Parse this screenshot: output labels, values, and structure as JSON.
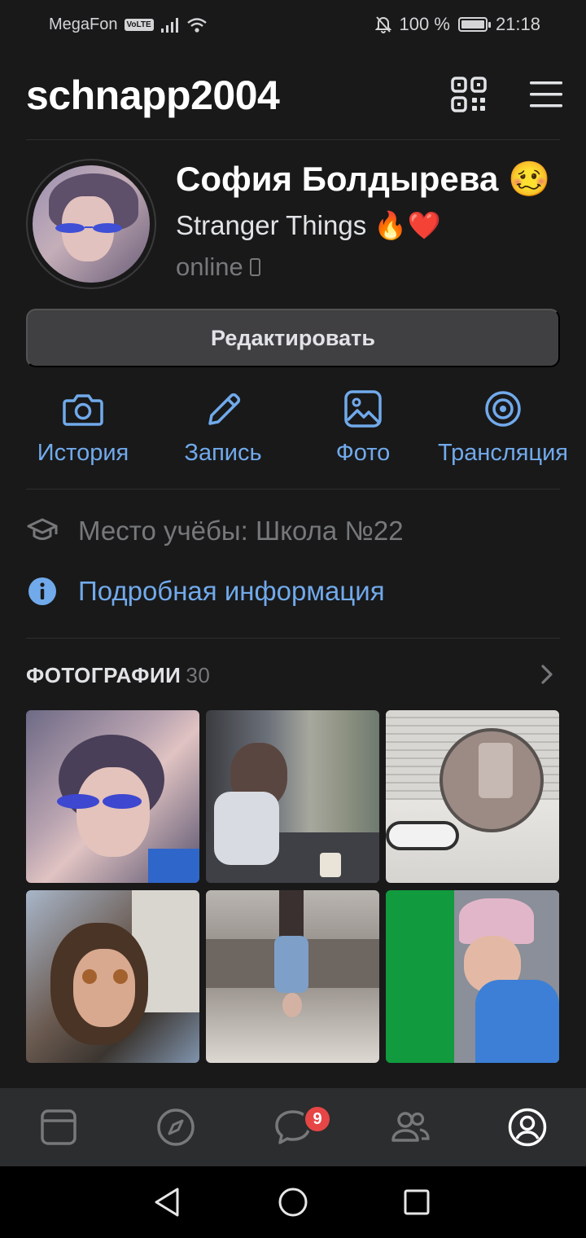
{
  "status_bar": {
    "carrier": "MegaFon",
    "network_badge": "VoLTE",
    "battery_text": "100 %",
    "battery_level": 1.0,
    "time": "21:18"
  },
  "header": {
    "username": "schnapp2004",
    "icons": [
      "qr-code-icon",
      "menu-icon"
    ]
  },
  "profile": {
    "name": "София Болдырева 🥴",
    "status": "Stranger Things 🔥❤️",
    "presence": "online"
  },
  "edit_button": {
    "label": "Редактировать"
  },
  "actions": [
    {
      "label": "История",
      "icon": "camera-icon"
    },
    {
      "label": "Запись",
      "icon": "pencil-icon"
    },
    {
      "label": "Фото",
      "icon": "image-icon"
    },
    {
      "label": "Трансляция",
      "icon": "broadcast-icon"
    }
  ],
  "info": {
    "education": "Место учёбы: Школа №22",
    "details_link": "Подробная информация"
  },
  "photos": {
    "title": "ФОТОГРАФИИ",
    "count": "30"
  },
  "tab_bar": {
    "tabs": [
      "news-icon",
      "discover-icon",
      "messages-icon",
      "friends-icon",
      "profile-icon"
    ],
    "messages_badge": "9",
    "active": "profile-icon"
  },
  "colors": {
    "background": "#19191a",
    "accent": "#71aaeb",
    "secondary_text": "#76787a",
    "badge": "#e64646"
  }
}
